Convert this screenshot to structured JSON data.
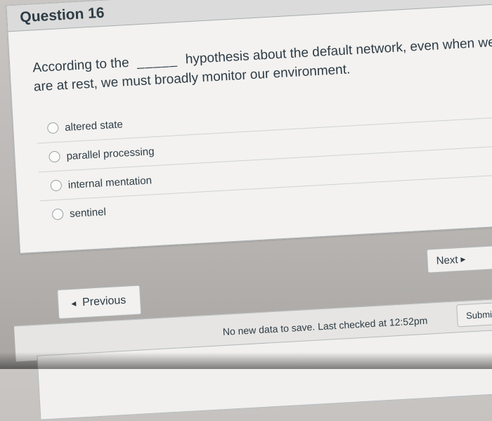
{
  "question": {
    "title": "Question 16",
    "text_before": "According to the",
    "blank": "_____",
    "text_after": "hypothesis about the default network, even when we are at rest, we must broadly monitor our environment."
  },
  "answers": [
    {
      "label": "altered state",
      "selected": false
    },
    {
      "label": "parallel processing",
      "selected": false
    },
    {
      "label": "internal mentation",
      "selected": false
    },
    {
      "label": "sentinel",
      "selected": false
    }
  ],
  "nav": {
    "next_label": "Next",
    "previous_label": "Previous",
    "submit_label": "Submi"
  },
  "footer": {
    "status_text": "No new data to save. Last checked at 12:52pm"
  },
  "icons": {
    "prev": "triangle-left-icon",
    "next": "triangle-right-icon",
    "radio": "radio-unselected-icon"
  }
}
